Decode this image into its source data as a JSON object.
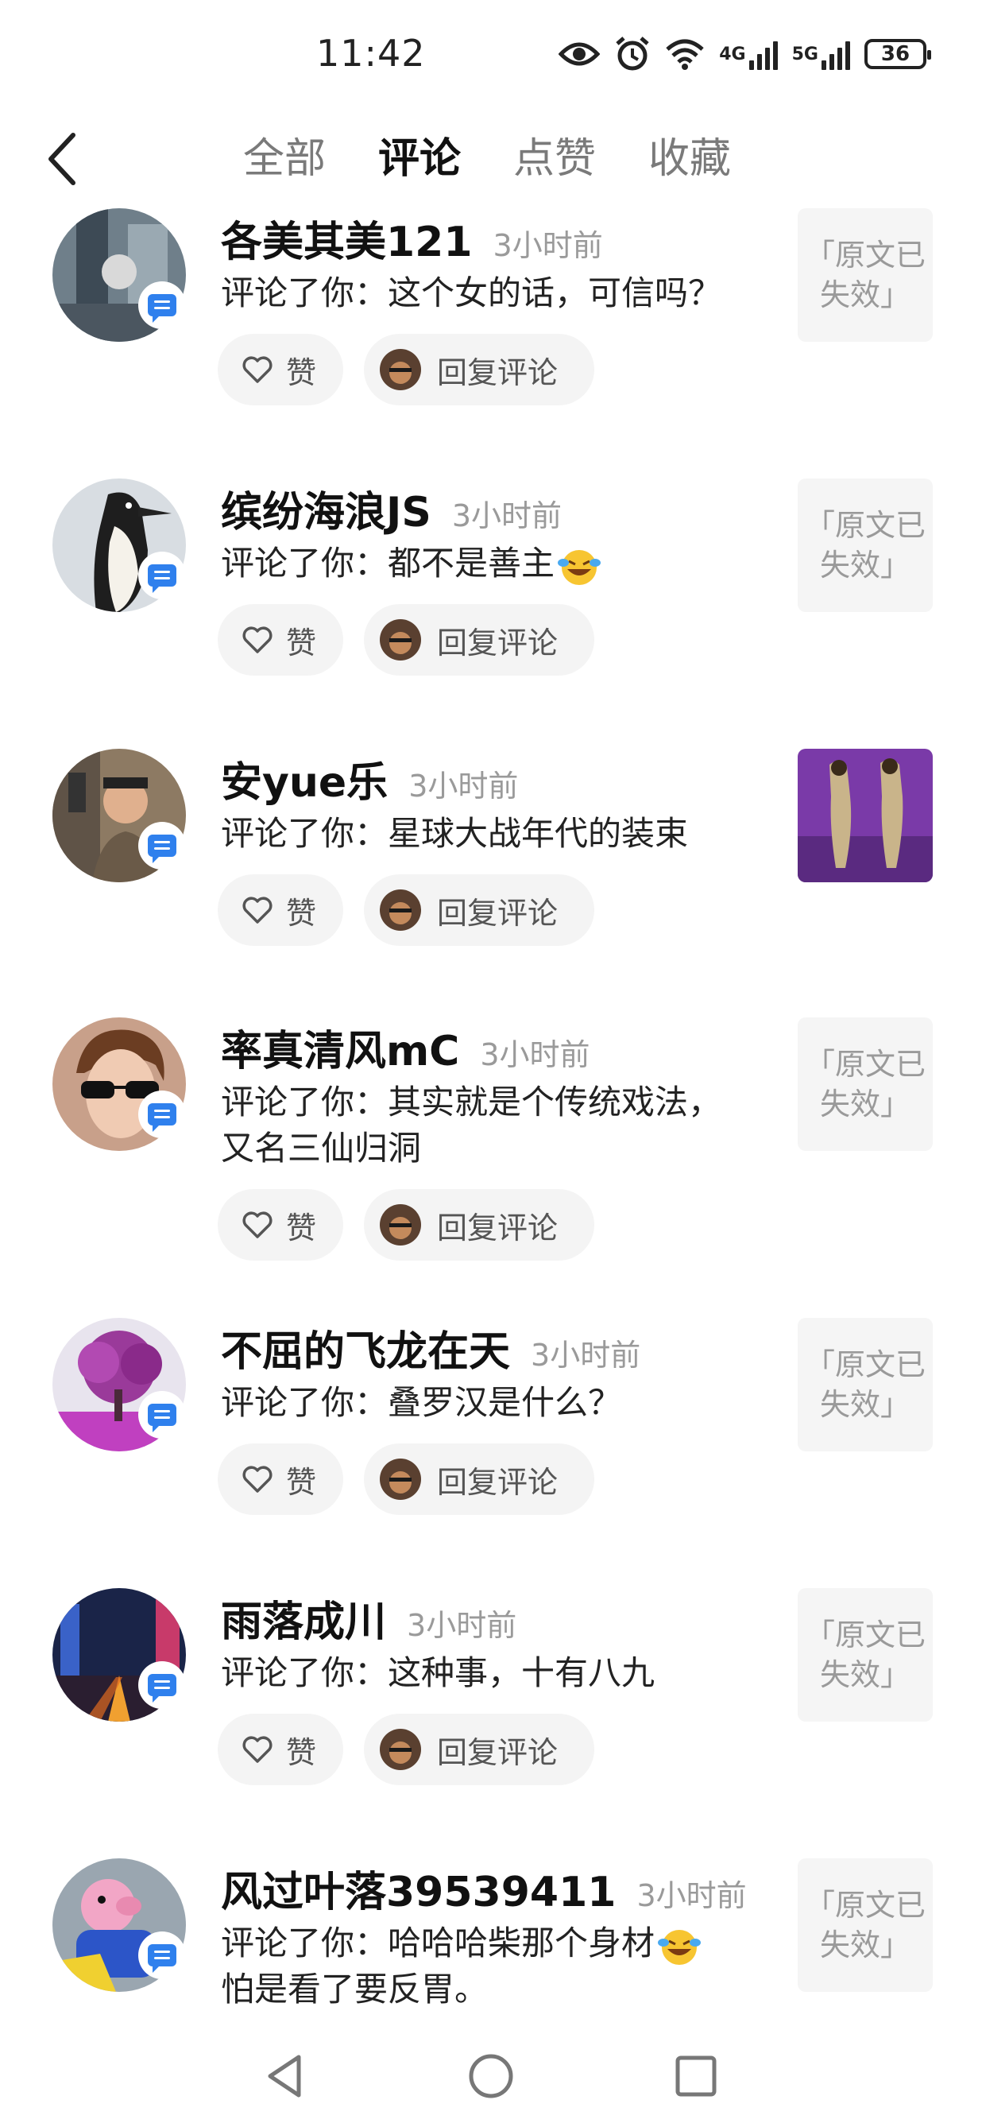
{
  "status": {
    "time": "11:42",
    "net1": "4G",
    "net2": "5G",
    "battery": "36"
  },
  "header": {
    "back_icon": "chevron-left-icon",
    "tabs": [
      {
        "label": "全部",
        "active": false
      },
      {
        "label": "评论",
        "active": true
      },
      {
        "label": "点赞",
        "active": false
      },
      {
        "label": "收藏",
        "active": false
      }
    ]
  },
  "items": [
    {
      "name": "各美其美121",
      "time": "3小时前",
      "comment": "评论了你：这个女的话，可信吗？",
      "like_label": "赞",
      "reply_label": "回复评论",
      "orig": "「原文已失效」",
      "orig_l1": "「原文已",
      "orig_l2": "失效」"
    },
    {
      "name": "缤纷海浪JS",
      "time": "3小时前",
      "comment": "评论了你：都不是善主",
      "like_label": "赞",
      "reply_label": "回复评论",
      "orig": "「原文已失效」",
      "orig_l1": "「原文已",
      "orig_l2": "失效」"
    },
    {
      "name": "安yue乐",
      "time": "3小时前",
      "comment": "评论了你：星球大战年代的装束",
      "like_label": "赞",
      "reply_label": "回复评论"
    },
    {
      "name": "率真清风mC",
      "time": "3小时前",
      "comment_l1": "评论了你：其实就是个传统戏法，",
      "comment_l2": "又名三仙归洞",
      "like_label": "赞",
      "reply_label": "回复评论",
      "orig_l1": "「原文已",
      "orig_l2": "失效」"
    },
    {
      "name": "不屈的飞龙在天",
      "time": "3小时前",
      "comment": "评论了你：叠罗汉是什么？",
      "like_label": "赞",
      "reply_label": "回复评论",
      "orig_l1": "「原文已",
      "orig_l2": "失效」"
    },
    {
      "name": "雨落成川",
      "time": "3小时前",
      "comment": "评论了你：这种事，十有八九",
      "like_label": "赞",
      "reply_label": "回复评论",
      "orig_l1": "「原文已",
      "orig_l2": "失效」"
    },
    {
      "name": "风过叶落39539411",
      "time": "3小时前",
      "comment_l1": "评论了你：哈哈哈柴那个身材",
      "comment_l2": "怕是看了要反胃。",
      "orig_l1": "「原文已",
      "orig_l2": "失效」"
    }
  ],
  "colors": {
    "accent": "#2f80ed",
    "secondary_text": "#9a9a9a",
    "button_bg": "#f4f4f4"
  }
}
